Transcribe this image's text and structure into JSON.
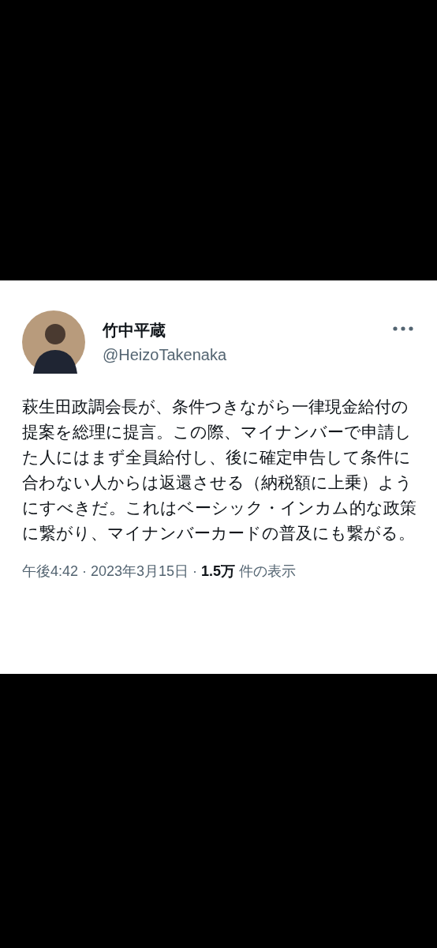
{
  "tweet": {
    "author": {
      "name": "竹中平蔵",
      "handle": "@HeizoTakenaka"
    },
    "text": "萩生田政調会長が、条件つきながら一律現金給付の提案を総理に提言。この際、マイナンバーで申請した人にはまず全員給付し、後に確定申告して条件に合わない人からは返還させる（納税額に上乗）ようにすべきだ。これはベーシック・インカム的な政策に繋がり、マイナンバーカードの普及にも繋がる。",
    "meta": "午後4:42 · 2023年3月15日 · **1.5万** 件の表示"
  }
}
